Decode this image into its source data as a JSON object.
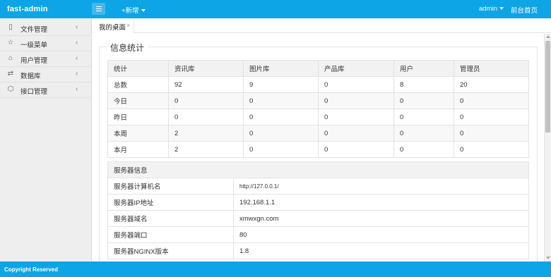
{
  "header": {
    "brand": "fast-admin",
    "menu_toggle_icon": "hamburger-icon",
    "add_menu": "+新增",
    "user": "admin",
    "home_link": "前台首页",
    "accent_color": "#0ea5e6"
  },
  "sidebar": {
    "items": [
      {
        "label": "文件管理",
        "icon": "file-icon"
      },
      {
        "label": "一级菜单",
        "icon": "star-icon"
      },
      {
        "label": "用户管理",
        "icon": "home-icon"
      },
      {
        "label": "数据库",
        "icon": "shuffle-icon"
      },
      {
        "label": "接口管理",
        "icon": "cube-icon"
      }
    ]
  },
  "tabs": [
    {
      "label": "我的桌面",
      "close": "×"
    }
  ],
  "main": {
    "section_title": "信息统计",
    "stats_table": {
      "headers": [
        "统计",
        "资讯库",
        "图片库",
        "产品库",
        "用户",
        "管理员"
      ],
      "rows": [
        [
          "总数",
          "92",
          "9",
          "0",
          "8",
          "20"
        ],
        [
          "今日",
          "0",
          "0",
          "0",
          "0",
          "0"
        ],
        [
          "昨日",
          "0",
          "0",
          "0",
          "0",
          "0"
        ],
        [
          "本周",
          "2",
          "0",
          "0",
          "0",
          "0"
        ],
        [
          "本月",
          "2",
          "0",
          "0",
          "0",
          "0"
        ]
      ]
    },
    "server_table": {
      "header": "服务器信息",
      "rows": [
        [
          "服务器计算机名",
          "http://127.0.0.1/"
        ],
        [
          "服务器IP地址",
          "192.168.1.1"
        ],
        [
          "服务器域名",
          "xmwxgn.com"
        ],
        [
          "服务器端口",
          "80"
        ],
        [
          "服务器NGINX版本",
          "1.8"
        ]
      ]
    }
  },
  "footer": {
    "text": "Copyright Reserved"
  }
}
